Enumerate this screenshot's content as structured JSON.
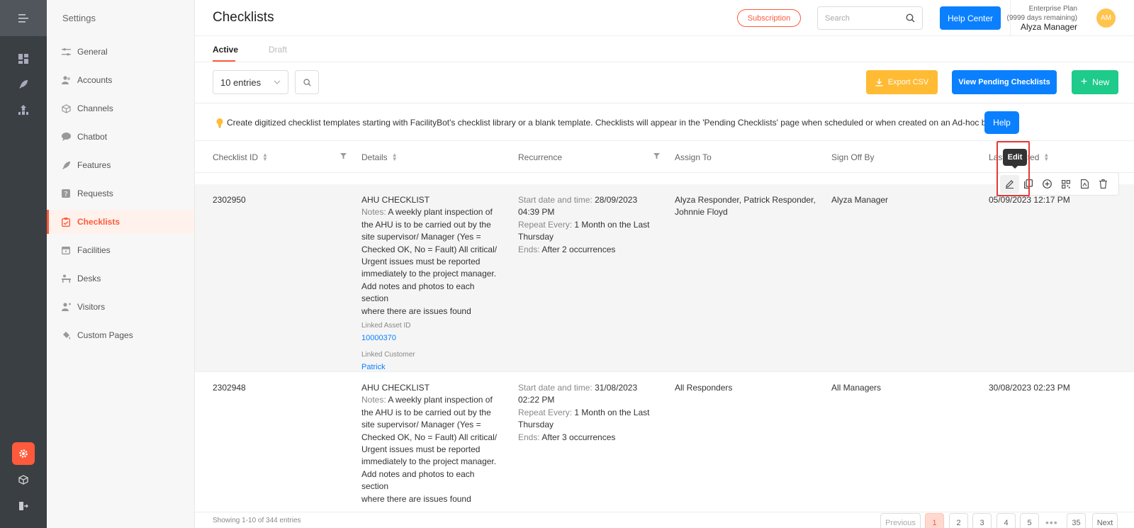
{
  "sidebar": {
    "title": "Settings",
    "items": [
      {
        "label": "General",
        "icon": "sliders-icon"
      },
      {
        "label": "Accounts",
        "icon": "users-icon"
      },
      {
        "label": "Channels",
        "icon": "cube-icon"
      },
      {
        "label": "Chatbot",
        "icon": "chat-icon"
      },
      {
        "label": "Features",
        "icon": "rocket-icon"
      },
      {
        "label": "Requests",
        "icon": "question-icon"
      },
      {
        "label": "Checklists",
        "icon": "checklist-icon"
      },
      {
        "label": "Facilities",
        "icon": "calendar-icon"
      },
      {
        "label": "Desks",
        "icon": "desk-icon"
      },
      {
        "label": "Visitors",
        "icon": "visitor-icon"
      },
      {
        "label": "Custom Pages",
        "icon": "paint-icon"
      }
    ]
  },
  "header": {
    "title": "Checklists",
    "subscription_label": "Subscription",
    "search_placeholder": "Search",
    "help_center_label": "Help Center",
    "plan_name": "Enterprise Plan",
    "plan_days": "(9999 days remaining)",
    "user_name": "Alyza Manager",
    "avatar_initials": "AM"
  },
  "tabs": {
    "active": "Active",
    "draft": "Draft"
  },
  "toolbar": {
    "entries_value": "10 entries",
    "export_label": "Export CSV",
    "pending_label": "View Pending Checklists",
    "new_label": "New"
  },
  "info": {
    "text": "Create digitized checklist templates starting with FacilityBot's checklist library or a blank template. Checklists will appear in the 'Pending Checklists' page when scheduled or when created on an Ad-hoc basis.",
    "help_label": "Help"
  },
  "table": {
    "columns": {
      "id": "Checklist ID",
      "details": "Details",
      "recurrence": "Recurrence",
      "assign": "Assign To",
      "signoff": "Sign Off By",
      "updated": "Last Updated"
    },
    "rows": [
      {
        "id": "2302950",
        "title": "AHU CHECKLIST",
        "notes_label": "Notes:",
        "notes_l1": "A weekly plant inspection of",
        "notes_rest": [
          "the AHU is to be carried out by the",
          "site supervisor/ Manager (Yes =",
          "Checked OK, No = Fault) All critical/",
          "Urgent issues must be reported",
          "immediately to the project manager.",
          "Add notes and photos to each section",
          "where there are issues found"
        ],
        "asset_label": "Linked Asset ID",
        "asset_value": "10000370",
        "customer_label": "Linked Customer",
        "customer_value": "Patrick",
        "start_label": "Start date and time:",
        "start_l1": "28/09/2023",
        "start_l2": "04:39 PM",
        "repeat_label": "Repeat Every:",
        "repeat_l1": "1 Month on the Last",
        "repeat_l2": "Thursday",
        "ends_label": "Ends:",
        "ends_value": "After 2 occurrences",
        "assign_l1": "Alyza Responder, Patrick Responder,",
        "assign_l2": "Johnnie Floyd",
        "signoff": "Alyza Manager",
        "updated": "05/09/2023 12:17 PM"
      },
      {
        "id": "2302948",
        "title": "AHU CHECKLIST",
        "notes_label": "Notes:",
        "notes_l1": "A weekly plant inspection of",
        "notes_rest": [
          "the AHU is to be carried out by the",
          "site supervisor/ Manager (Yes =",
          "Checked OK, No = Fault) All critical/",
          "Urgent issues must be reported",
          "immediately to the project manager.",
          "Add notes and photos to each section",
          "where there are issues found"
        ],
        "start_label": "Start date and time:",
        "start_l1": "31/08/2023",
        "start_l2": "02:22 PM",
        "repeat_label": "Repeat Every:",
        "repeat_l1": "1 Month on the Last",
        "repeat_l2": "Thursday",
        "ends_label": "Ends:",
        "ends_value": "After 3 occurrences",
        "assign_l1": "All Responders",
        "signoff": "All Managers",
        "updated": "30/08/2023 02:23 PM"
      }
    ]
  },
  "row_actions": {
    "tooltip": "Edit",
    "icons": [
      "edit-icon",
      "copy-icon",
      "add-circle-icon",
      "qr-code-icon",
      "pdf-icon",
      "delete-icon"
    ]
  },
  "footer": {
    "showing": "Showing 1-10 of 344 entries",
    "previous": "Previous",
    "pages": [
      "1",
      "2",
      "3",
      "4",
      "5"
    ],
    "last_page": "35",
    "ellipsis": "•••",
    "next": "Next"
  },
  "colors": {
    "accent": "#ff5a3c",
    "primary": "#0b80ff",
    "warning": "#ffbb33",
    "success": "#1ecb8a"
  }
}
